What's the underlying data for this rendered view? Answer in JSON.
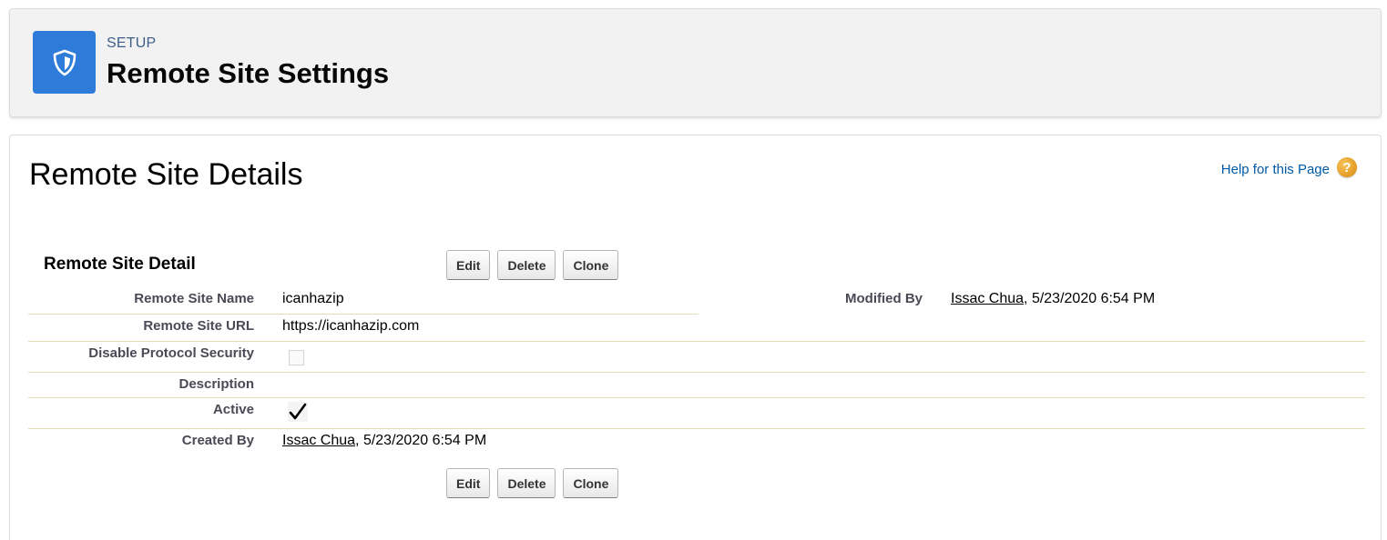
{
  "header": {
    "eyebrow": "SETUP",
    "title": "Remote Site Settings",
    "icon": "shield-icon"
  },
  "page": {
    "title": "Remote Site Details",
    "help_link": "Help for this Page",
    "help_icon": "?"
  },
  "detail": {
    "section_title": "Remote Site Detail",
    "buttons": {
      "edit": "Edit",
      "delete": "Delete",
      "clone": "Clone"
    },
    "fields": {
      "remote_site_name": {
        "label": "Remote Site Name",
        "value": "icanhazip"
      },
      "remote_site_url": {
        "label": "Remote Site URL",
        "value": "https://icanhazip.com"
      },
      "disable_protocol_security": {
        "label": "Disable Protocol Security",
        "checked": false
      },
      "description": {
        "label": "Description",
        "value": ""
      },
      "active": {
        "label": "Active",
        "checked": true
      },
      "created_by": {
        "label": "Created By",
        "user": "Issac Chua",
        "timestamp": ", 5/23/2020 6:54 PM"
      },
      "modified_by": {
        "label": "Modified By",
        "user": "Issac Chua",
        "timestamp": ", 5/23/2020 6:54 PM"
      }
    }
  },
  "colors": {
    "accent": "#2e7bd9",
    "link": "#015ba7",
    "help_icon": "#e8a317"
  }
}
